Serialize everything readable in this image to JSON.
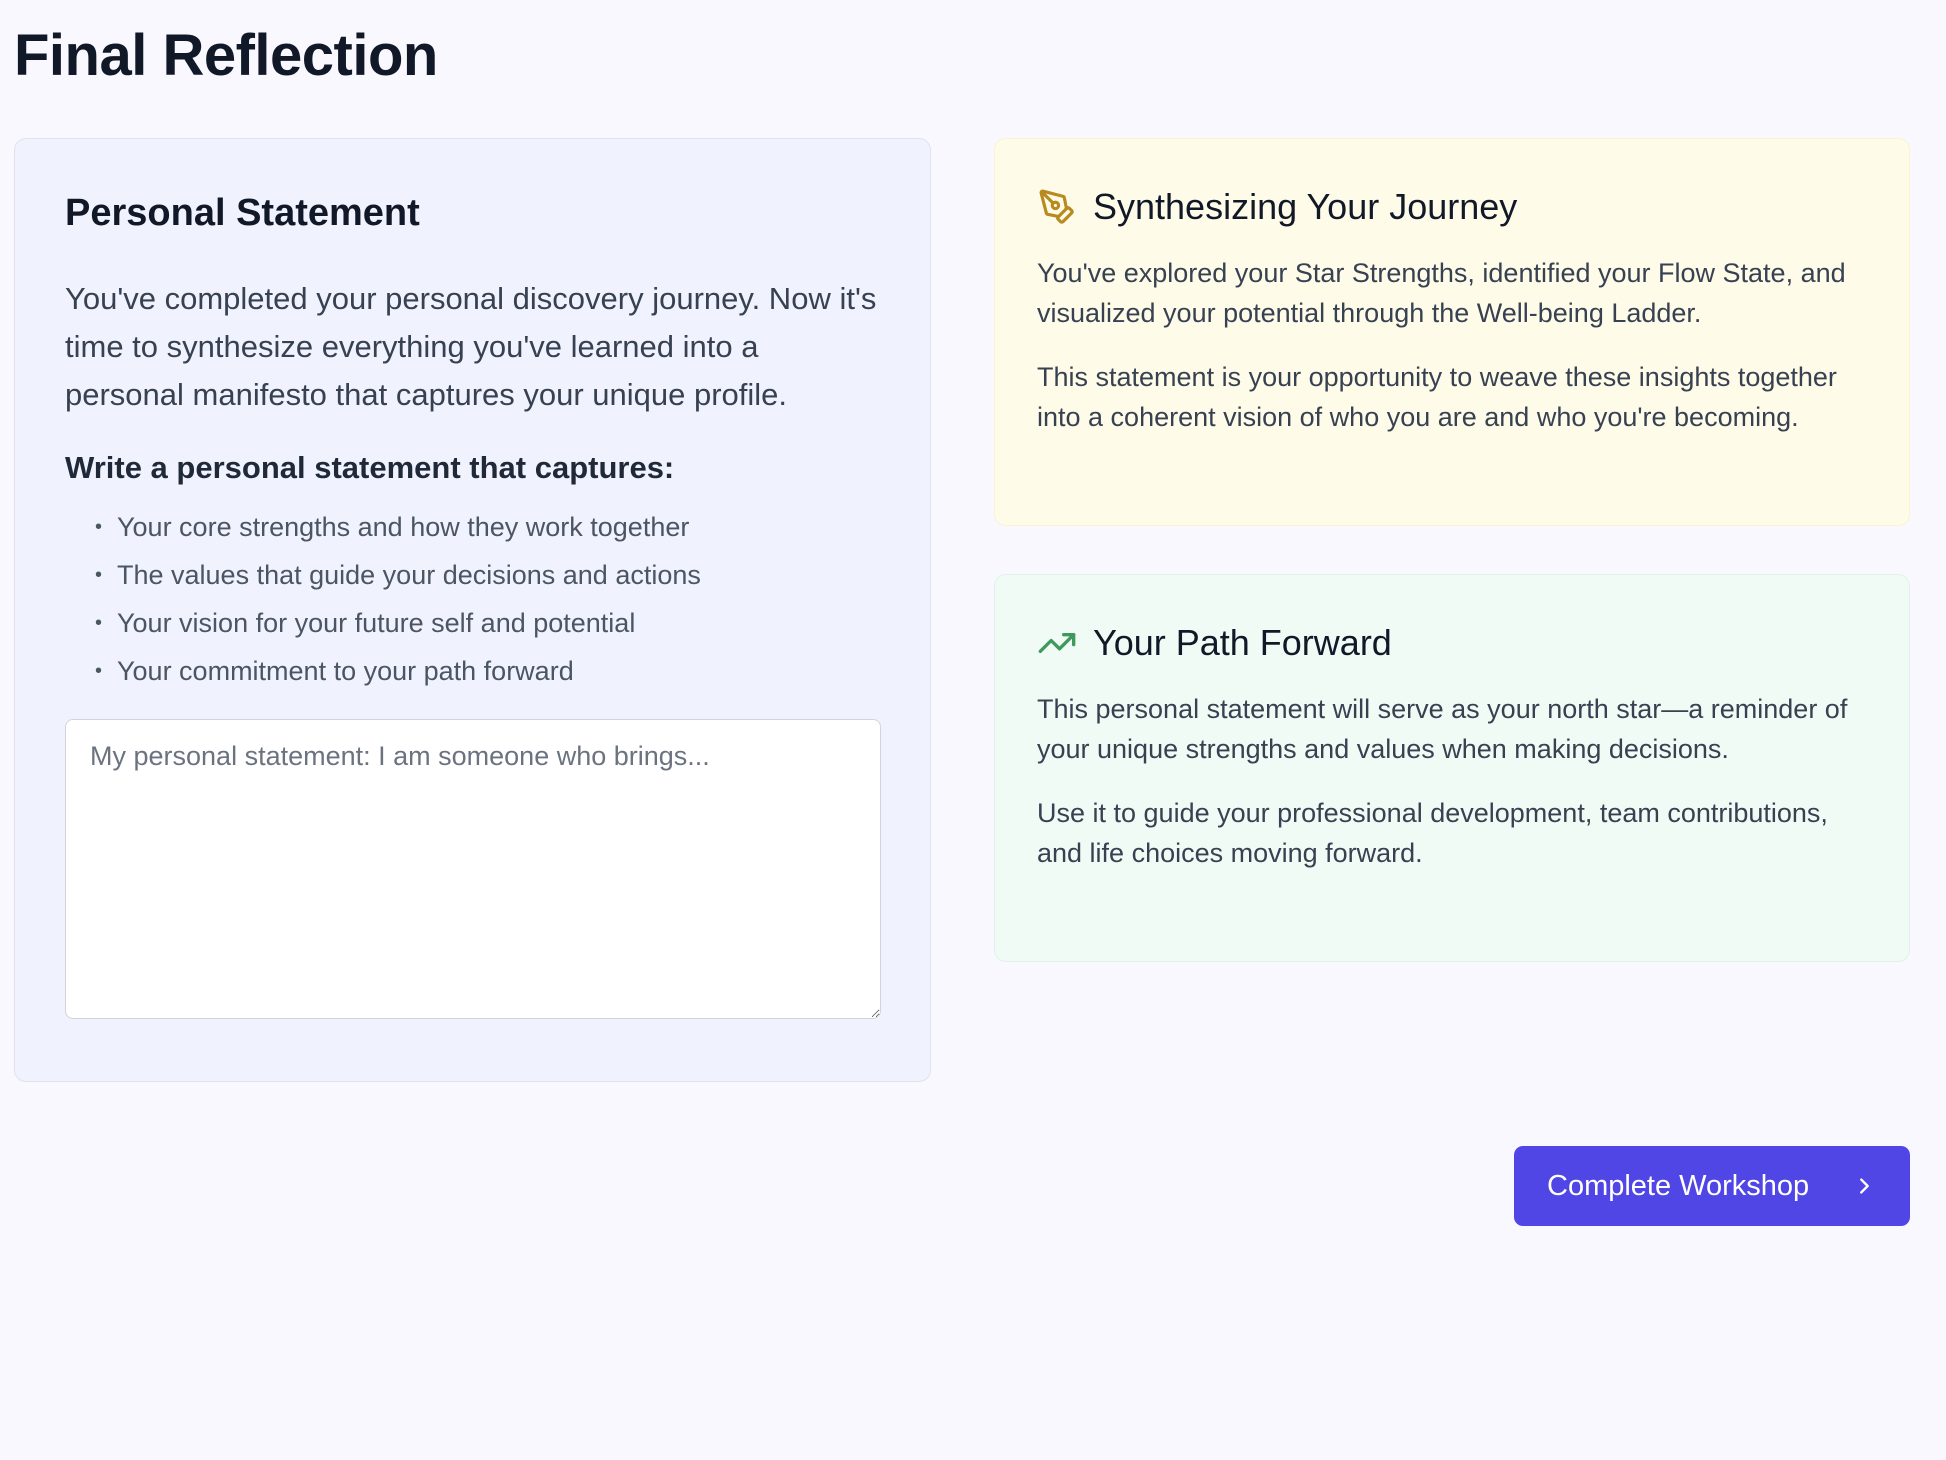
{
  "page": {
    "title": "Final Reflection"
  },
  "personal_statement": {
    "heading": "Personal Statement",
    "intro": "You've completed your personal discovery journey. Now it's time to synthesize everything you've learned into a personal manifesto that captures your unique profile.",
    "prompt_heading": "Write a personal statement that captures:",
    "bullets": [
      "Your core strengths and how they work together",
      "The values that guide your decisions and actions",
      "Your vision for your future self and potential",
      "Your commitment to your path forward"
    ],
    "input": {
      "value": "",
      "placeholder": "My personal statement: I am someone who brings..."
    }
  },
  "synthesizing_card": {
    "icon": "pen-tool-icon",
    "icon_color": "#b88a1f",
    "background": "#fefce9",
    "title": "Synthesizing Your Journey",
    "paragraphs": [
      "You've explored your Star Strengths, identified your Flow State, and visualized your potential through the Well-being Ladder.",
      "This statement is your opportunity to weave these insights together into a coherent vision of who you are and who you're becoming."
    ]
  },
  "path_card": {
    "icon": "trending-up-icon",
    "icon_color": "#3f9a5a",
    "background": "#f0fbf5",
    "title": "Your Path Forward",
    "paragraphs": [
      "This personal statement will serve as your north star—a reminder of your unique strengths and values when making decisions.",
      "Use it to guide your professional development, team contributions, and life choices moving forward."
    ]
  },
  "actions": {
    "complete_label": "Complete Workshop",
    "complete_icon": "chevron-right-icon",
    "accent_color": "#4f46e5"
  }
}
